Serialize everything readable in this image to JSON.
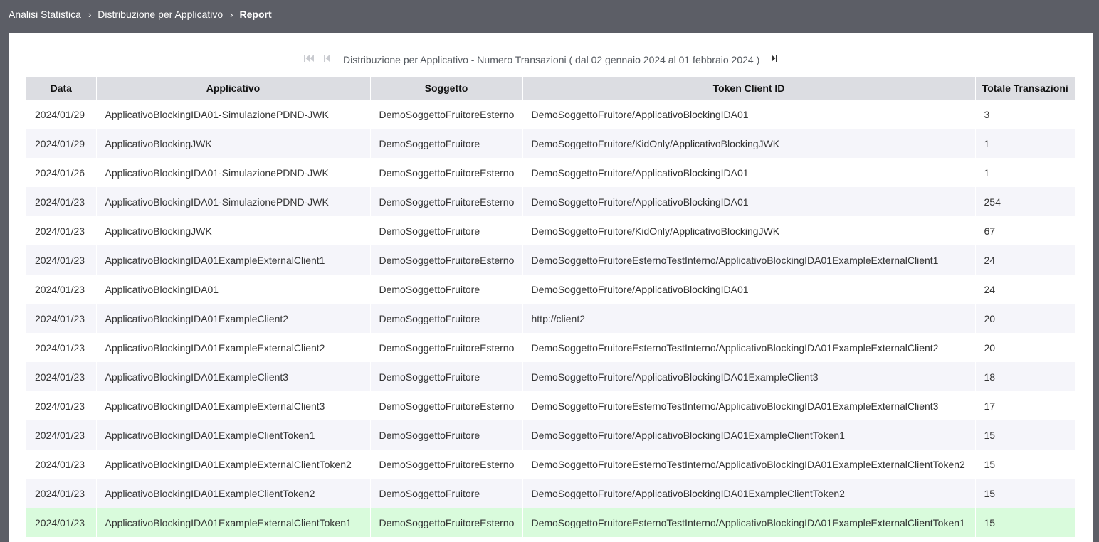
{
  "breadcrumb": {
    "items": [
      "Analisi Statistica",
      "Distribuzione per Applicativo",
      "Report"
    ],
    "separator": "›"
  },
  "pager": {
    "title": "Distribuzione per Applicativo - Numero Transazioni ( dal 02 gennaio 2024 al 01 febbraio 2024 )",
    "icons": [
      "first-page-icon",
      "previous-page-icon",
      "last-page-icon"
    ]
  },
  "table": {
    "columns": [
      "Data",
      "Applicativo",
      "Soggetto",
      "Token Client ID",
      "Totale Transazioni"
    ],
    "rows": [
      [
        "2024/01/29",
        "ApplicativoBlockingIDA01-SimulazionePDND-JWK",
        "DemoSoggettoFruitoreEsterno",
        "DemoSoggettoFruitore/ApplicativoBlockingIDA01",
        "3"
      ],
      [
        "2024/01/29",
        "ApplicativoBlockingJWK",
        "DemoSoggettoFruitore",
        "DemoSoggettoFruitore/KidOnly/ApplicativoBlockingJWK",
        "1"
      ],
      [
        "2024/01/26",
        "ApplicativoBlockingIDA01-SimulazionePDND-JWK",
        "DemoSoggettoFruitoreEsterno",
        "DemoSoggettoFruitore/ApplicativoBlockingIDA01",
        "1"
      ],
      [
        "2024/01/23",
        "ApplicativoBlockingIDA01-SimulazionePDND-JWK",
        "DemoSoggettoFruitoreEsterno",
        "DemoSoggettoFruitore/ApplicativoBlockingIDA01",
        "254"
      ],
      [
        "2024/01/23",
        "ApplicativoBlockingJWK",
        "DemoSoggettoFruitore",
        "DemoSoggettoFruitore/KidOnly/ApplicativoBlockingJWK",
        "67"
      ],
      [
        "2024/01/23",
        "ApplicativoBlockingIDA01ExampleExternalClient1",
        "DemoSoggettoFruitoreEsterno",
        "DemoSoggettoFruitoreEsternoTestInterno/ApplicativoBlockingIDA01ExampleExternalClient1",
        "24"
      ],
      [
        "2024/01/23",
        "ApplicativoBlockingIDA01",
        "DemoSoggettoFruitore",
        "DemoSoggettoFruitore/ApplicativoBlockingIDA01",
        "24"
      ],
      [
        "2024/01/23",
        "ApplicativoBlockingIDA01ExampleClient2",
        "DemoSoggettoFruitore",
        "http://client2",
        "20"
      ],
      [
        "2024/01/23",
        "ApplicativoBlockingIDA01ExampleExternalClient2",
        "DemoSoggettoFruitoreEsterno",
        "DemoSoggettoFruitoreEsternoTestInterno/ApplicativoBlockingIDA01ExampleExternalClient2",
        "20"
      ],
      [
        "2024/01/23",
        "ApplicativoBlockingIDA01ExampleClient3",
        "DemoSoggettoFruitore",
        "DemoSoggettoFruitore/ApplicativoBlockingIDA01ExampleClient3",
        "18"
      ],
      [
        "2024/01/23",
        "ApplicativoBlockingIDA01ExampleExternalClient3",
        "DemoSoggettoFruitoreEsterno",
        "DemoSoggettoFruitoreEsternoTestInterno/ApplicativoBlockingIDA01ExampleExternalClient3",
        "17"
      ],
      [
        "2024/01/23",
        "ApplicativoBlockingIDA01ExampleClientToken1",
        "DemoSoggettoFruitore",
        "DemoSoggettoFruitore/ApplicativoBlockingIDA01ExampleClientToken1",
        "15"
      ],
      [
        "2024/01/23",
        "ApplicativoBlockingIDA01ExampleExternalClientToken2",
        "DemoSoggettoFruitoreEsterno",
        "DemoSoggettoFruitoreEsternoTestInterno/ApplicativoBlockingIDA01ExampleExternalClientToken2",
        "15"
      ],
      [
        "2024/01/23",
        "ApplicativoBlockingIDA01ExampleClientToken2",
        "DemoSoggettoFruitore",
        "DemoSoggettoFruitore/ApplicativoBlockingIDA01ExampleClientToken2",
        "15"
      ],
      [
        "2024/01/23",
        "ApplicativoBlockingIDA01ExampleExternalClientToken1",
        "DemoSoggettoFruitoreEsterno",
        "DemoSoggettoFruitoreEsternoTestInterno/ApplicativoBlockingIDA01ExampleExternalClientToken1",
        "15"
      ]
    ],
    "selected_row": 14
  },
  "colors": {
    "topbar": "#5c5e66",
    "header_bg": "#dcdde2",
    "row_alt": "#f5f5fa",
    "row_selected": "#d9fbdc"
  }
}
